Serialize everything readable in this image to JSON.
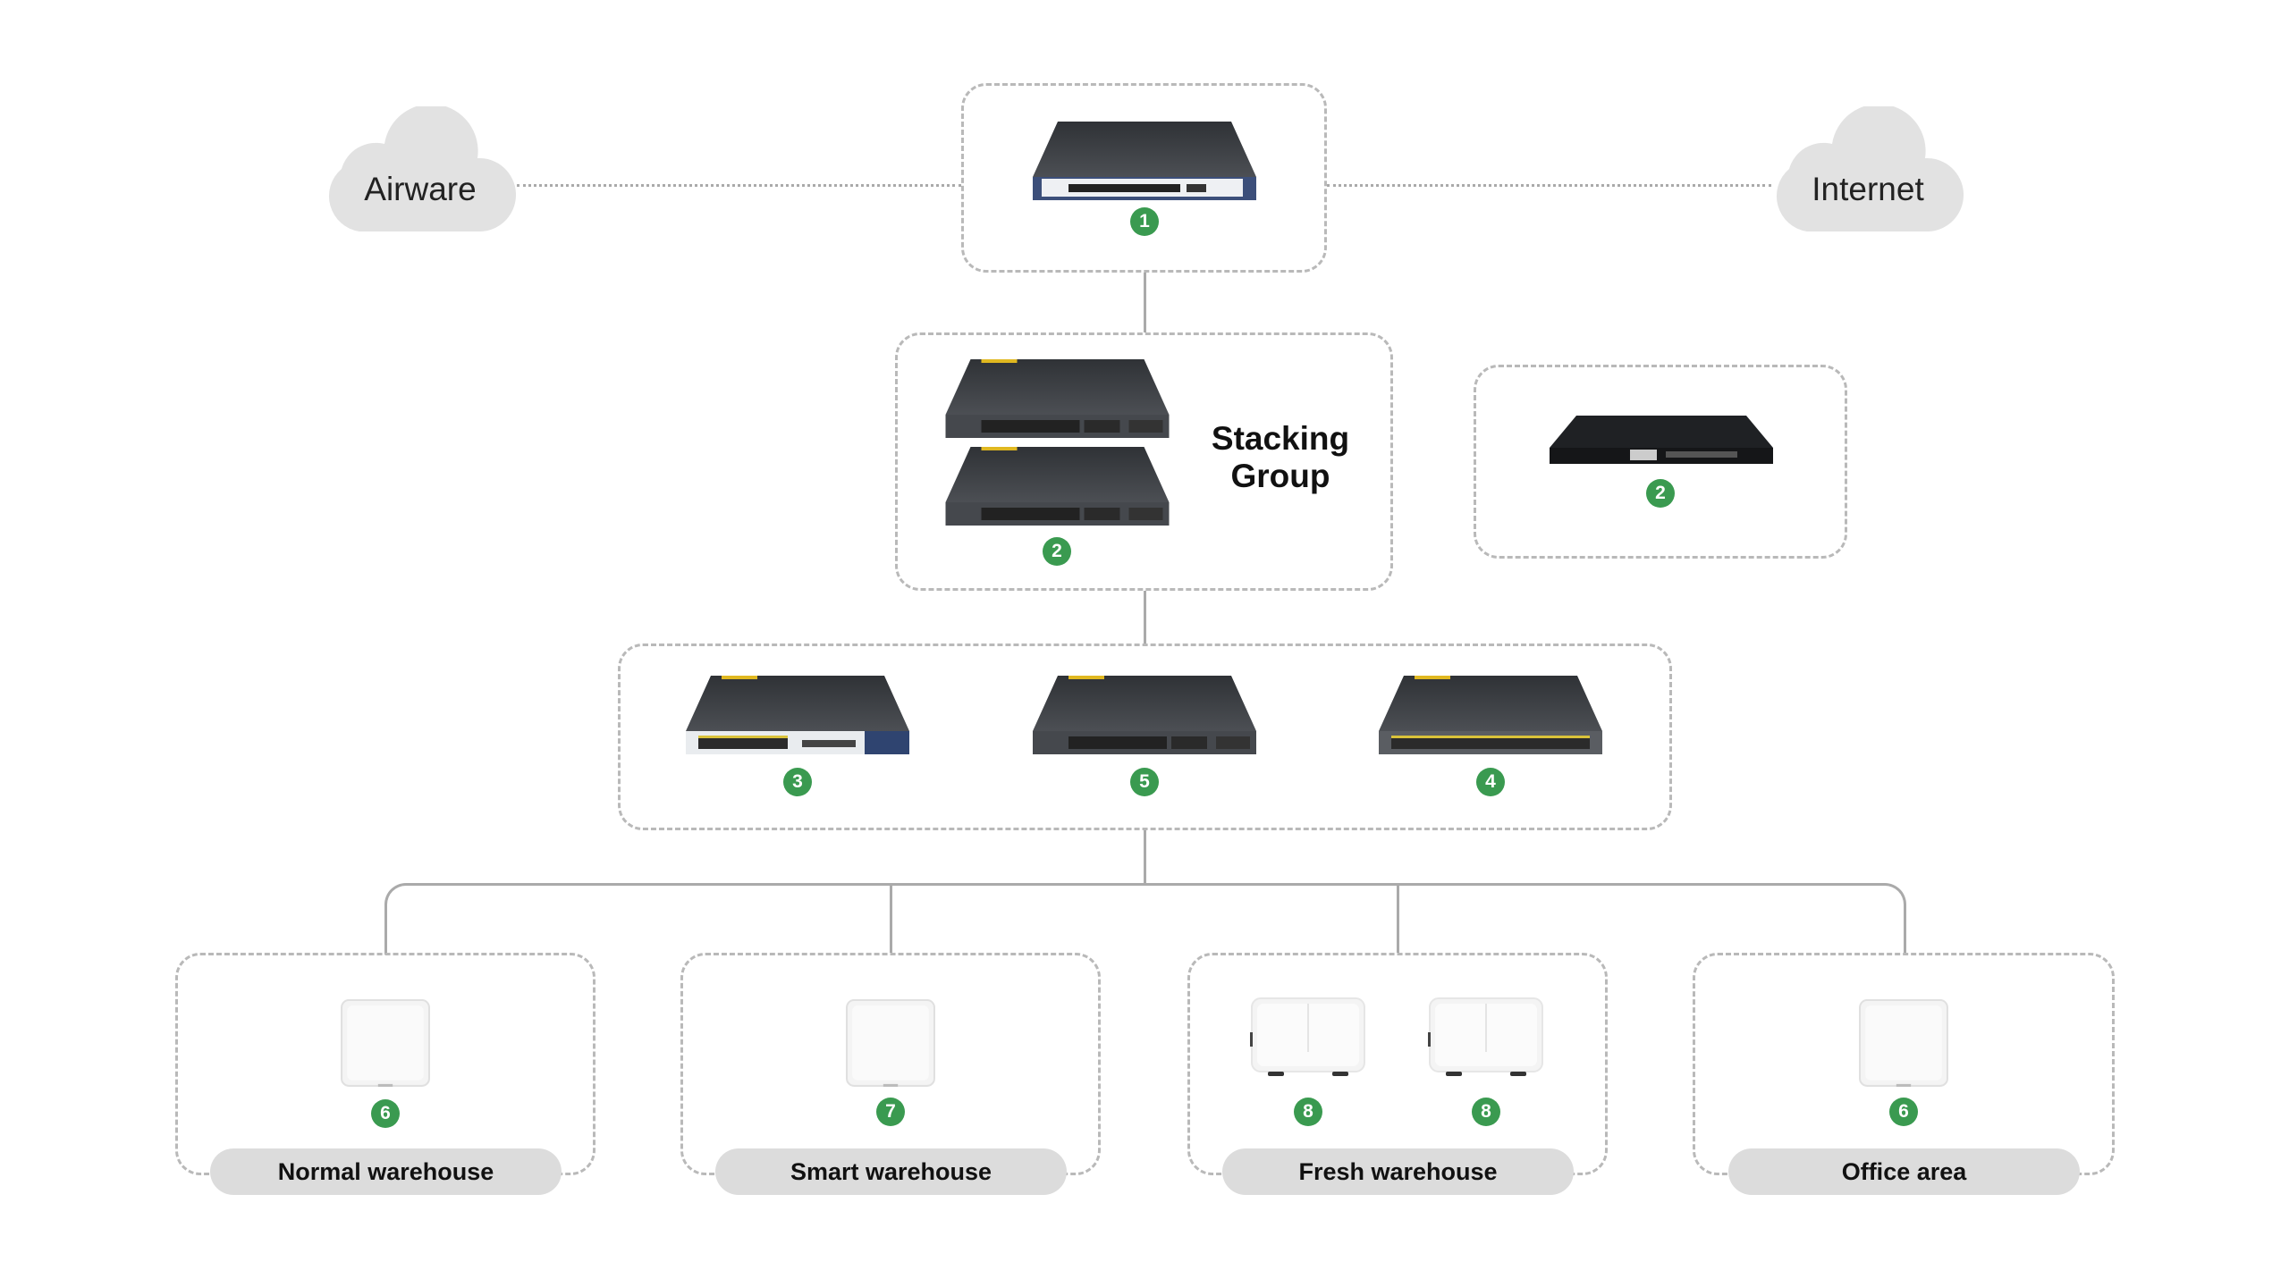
{
  "clouds": {
    "left": "Airware",
    "right": "Internet"
  },
  "stacking_label": "Stacking Group",
  "badges": {
    "gateway": "1",
    "stack": "2",
    "standalone": "2",
    "access_left": "3",
    "access_mid": "5",
    "access_right": "4",
    "normal": "6",
    "smart": "7",
    "fresh_a": "8",
    "fresh_b": "8",
    "office": "6"
  },
  "areas": [
    "Normal warehouse",
    "Smart warehouse",
    "Fresh warehouse",
    "Office area"
  ],
  "colors": {
    "badge": "#3a9a50",
    "line": "#aaaaaa",
    "pill": "#dcdcdc",
    "device": "#3a3d42"
  }
}
